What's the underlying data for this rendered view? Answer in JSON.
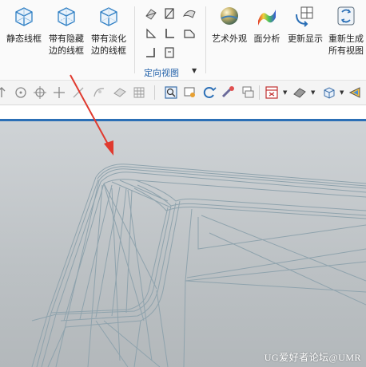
{
  "ribbon": {
    "buttons": [
      {
        "name": "static-wireframe",
        "label": "静态线框"
      },
      {
        "name": "hidden-edge-wireframe",
        "label": "带有隐藏\n边的线框"
      },
      {
        "name": "dimmed-edge-wireframe",
        "label": "带有淡化\n边的线框"
      },
      {
        "name": "artistic-appearance",
        "label": "艺术外观"
      },
      {
        "name": "face-analysis",
        "label": "面分析"
      },
      {
        "name": "update-display",
        "label": "更新显示"
      },
      {
        "name": "regenerate-all-views",
        "label": "重新生成\n所有视图"
      }
    ],
    "group_label": "定向视图"
  },
  "watermark": "UG爱好者论坛@UMR",
  "colors": {
    "accent_blue": "#2b6fb6",
    "annotation_arrow": "#e03a2f",
    "wireframe": "#8fa3ad"
  }
}
